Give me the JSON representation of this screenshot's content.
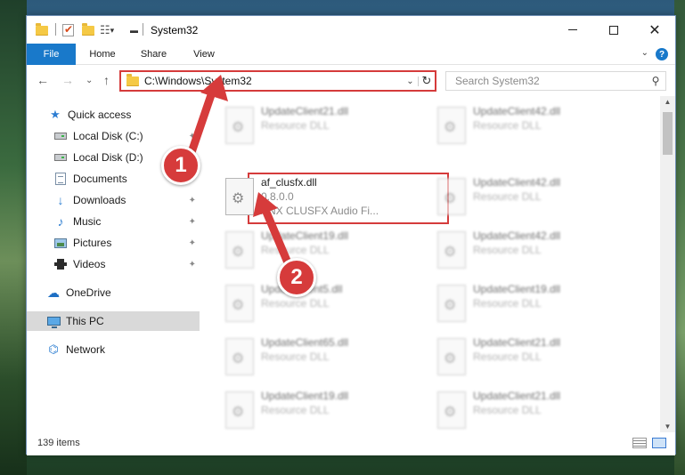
{
  "window": {
    "title": "System32"
  },
  "ribbon": {
    "tabs": [
      "File",
      "Home",
      "Share",
      "View"
    ],
    "help": "?"
  },
  "nav": {
    "address": "C:\\Windows\\System32",
    "search_placeholder": "Search System32"
  },
  "sidebar": {
    "items": [
      {
        "label": "Quick access",
        "icon": "star-icon",
        "pinned": false
      },
      {
        "label": "Local Disk (C:)",
        "icon": "drive-icon",
        "pinned": true
      },
      {
        "label": "Local Disk (D:)",
        "icon": "drive-icon",
        "pinned": true
      },
      {
        "label": "Documents",
        "icon": "documents-icon",
        "pinned": true
      },
      {
        "label": "Downloads",
        "icon": "downloads-icon",
        "pinned": true
      },
      {
        "label": "Music",
        "icon": "music-icon",
        "pinned": true
      },
      {
        "label": "Pictures",
        "icon": "pictures-icon",
        "pinned": true
      },
      {
        "label": "Videos",
        "icon": "videos-icon",
        "pinned": true
      },
      {
        "label": "OneDrive",
        "icon": "onedrive-icon",
        "pinned": false
      },
      {
        "label": "This PC",
        "icon": "this-pc-icon",
        "pinned": false,
        "selected": true
      },
      {
        "label": "Network",
        "icon": "network-icon",
        "pinned": false
      }
    ]
  },
  "files": {
    "left": [
      {
        "name": "UpdateClient21.dll",
        "sub": "Resource DLL"
      },
      {
        "name": "af_clusfx.dll",
        "sub": "0.8.0.0",
        "sub2": "ANX CLUSFX Audio Fi..."
      },
      {
        "name": "UpdateClient19.dll",
        "sub": "Resource DLL"
      },
      {
        "name": "UpdateClient5.dll",
        "sub": "Resource DLL"
      },
      {
        "name": "UpdateClient65.dll",
        "sub": "Resource DLL"
      },
      {
        "name": "UpdateClient19.dll",
        "sub": "Resource DLL"
      }
    ],
    "right": [
      {
        "name": "UpdateClient42.dll",
        "sub": "Resource DLL"
      },
      {
        "name": "UpdateClient42.dll",
        "sub": "Resource DLL"
      },
      {
        "name": "UpdateClient42.dll",
        "sub": "Resource DLL"
      },
      {
        "name": "UpdateClient19.dll",
        "sub": "Resource DLL"
      },
      {
        "name": "UpdateClient21.dll",
        "sub": "Resource DLL"
      },
      {
        "name": "UpdateClient21.dll",
        "sub": "Resource DLL"
      }
    ]
  },
  "status": {
    "items_count": "139 items"
  },
  "annotations": {
    "step1": "1",
    "step2": "2",
    "color": "#d63b3b"
  }
}
